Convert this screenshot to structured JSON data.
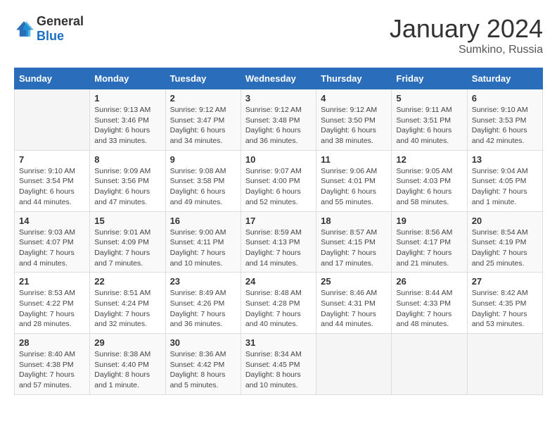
{
  "logo": {
    "general": "General",
    "blue": "Blue"
  },
  "title": {
    "month_year": "January 2024",
    "location": "Sumkino, Russia"
  },
  "weekdays": [
    "Sunday",
    "Monday",
    "Tuesday",
    "Wednesday",
    "Thursday",
    "Friday",
    "Saturday"
  ],
  "weeks": [
    [
      {
        "day": "",
        "sunrise": "",
        "sunset": "",
        "daylight": ""
      },
      {
        "day": "1",
        "sunrise": "9:13 AM",
        "sunset": "3:46 PM",
        "daylight": "6 hours and 33 minutes."
      },
      {
        "day": "2",
        "sunrise": "9:12 AM",
        "sunset": "3:47 PM",
        "daylight": "6 hours and 34 minutes."
      },
      {
        "day": "3",
        "sunrise": "9:12 AM",
        "sunset": "3:48 PM",
        "daylight": "6 hours and 36 minutes."
      },
      {
        "day": "4",
        "sunrise": "9:12 AM",
        "sunset": "3:50 PM",
        "daylight": "6 hours and 38 minutes."
      },
      {
        "day": "5",
        "sunrise": "9:11 AM",
        "sunset": "3:51 PM",
        "daylight": "6 hours and 40 minutes."
      },
      {
        "day": "6",
        "sunrise": "9:10 AM",
        "sunset": "3:53 PM",
        "daylight": "6 hours and 42 minutes."
      }
    ],
    [
      {
        "day": "7",
        "sunrise": "9:10 AM",
        "sunset": "3:54 PM",
        "daylight": "6 hours and 44 minutes."
      },
      {
        "day": "8",
        "sunrise": "9:09 AM",
        "sunset": "3:56 PM",
        "daylight": "6 hours and 47 minutes."
      },
      {
        "day": "9",
        "sunrise": "9:08 AM",
        "sunset": "3:58 PM",
        "daylight": "6 hours and 49 minutes."
      },
      {
        "day": "10",
        "sunrise": "9:07 AM",
        "sunset": "4:00 PM",
        "daylight": "6 hours and 52 minutes."
      },
      {
        "day": "11",
        "sunrise": "9:06 AM",
        "sunset": "4:01 PM",
        "daylight": "6 hours and 55 minutes."
      },
      {
        "day": "12",
        "sunrise": "9:05 AM",
        "sunset": "4:03 PM",
        "daylight": "6 hours and 58 minutes."
      },
      {
        "day": "13",
        "sunrise": "9:04 AM",
        "sunset": "4:05 PM",
        "daylight": "7 hours and 1 minute."
      }
    ],
    [
      {
        "day": "14",
        "sunrise": "9:03 AM",
        "sunset": "4:07 PM",
        "daylight": "7 hours and 4 minutes."
      },
      {
        "day": "15",
        "sunrise": "9:01 AM",
        "sunset": "4:09 PM",
        "daylight": "7 hours and 7 minutes."
      },
      {
        "day": "16",
        "sunrise": "9:00 AM",
        "sunset": "4:11 PM",
        "daylight": "7 hours and 10 minutes."
      },
      {
        "day": "17",
        "sunrise": "8:59 AM",
        "sunset": "4:13 PM",
        "daylight": "7 hours and 14 minutes."
      },
      {
        "day": "18",
        "sunrise": "8:57 AM",
        "sunset": "4:15 PM",
        "daylight": "7 hours and 17 minutes."
      },
      {
        "day": "19",
        "sunrise": "8:56 AM",
        "sunset": "4:17 PM",
        "daylight": "7 hours and 21 minutes."
      },
      {
        "day": "20",
        "sunrise": "8:54 AM",
        "sunset": "4:19 PM",
        "daylight": "7 hours and 25 minutes."
      }
    ],
    [
      {
        "day": "21",
        "sunrise": "8:53 AM",
        "sunset": "4:22 PM",
        "daylight": "7 hours and 28 minutes."
      },
      {
        "day": "22",
        "sunrise": "8:51 AM",
        "sunset": "4:24 PM",
        "daylight": "7 hours and 32 minutes."
      },
      {
        "day": "23",
        "sunrise": "8:49 AM",
        "sunset": "4:26 PM",
        "daylight": "7 hours and 36 minutes."
      },
      {
        "day": "24",
        "sunrise": "8:48 AM",
        "sunset": "4:28 PM",
        "daylight": "7 hours and 40 minutes."
      },
      {
        "day": "25",
        "sunrise": "8:46 AM",
        "sunset": "4:31 PM",
        "daylight": "7 hours and 44 minutes."
      },
      {
        "day": "26",
        "sunrise": "8:44 AM",
        "sunset": "4:33 PM",
        "daylight": "7 hours and 48 minutes."
      },
      {
        "day": "27",
        "sunrise": "8:42 AM",
        "sunset": "4:35 PM",
        "daylight": "7 hours and 53 minutes."
      }
    ],
    [
      {
        "day": "28",
        "sunrise": "8:40 AM",
        "sunset": "4:38 PM",
        "daylight": "7 hours and 57 minutes."
      },
      {
        "day": "29",
        "sunrise": "8:38 AM",
        "sunset": "4:40 PM",
        "daylight": "8 hours and 1 minute."
      },
      {
        "day": "30",
        "sunrise": "8:36 AM",
        "sunset": "4:42 PM",
        "daylight": "8 hours and 5 minutes."
      },
      {
        "day": "31",
        "sunrise": "8:34 AM",
        "sunset": "4:45 PM",
        "daylight": "8 hours and 10 minutes."
      },
      {
        "day": "",
        "sunrise": "",
        "sunset": "",
        "daylight": ""
      },
      {
        "day": "",
        "sunrise": "",
        "sunset": "",
        "daylight": ""
      },
      {
        "day": "",
        "sunrise": "",
        "sunset": "",
        "daylight": ""
      }
    ]
  ],
  "labels": {
    "sunrise": "Sunrise:",
    "sunset": "Sunset:",
    "daylight": "Daylight:"
  }
}
